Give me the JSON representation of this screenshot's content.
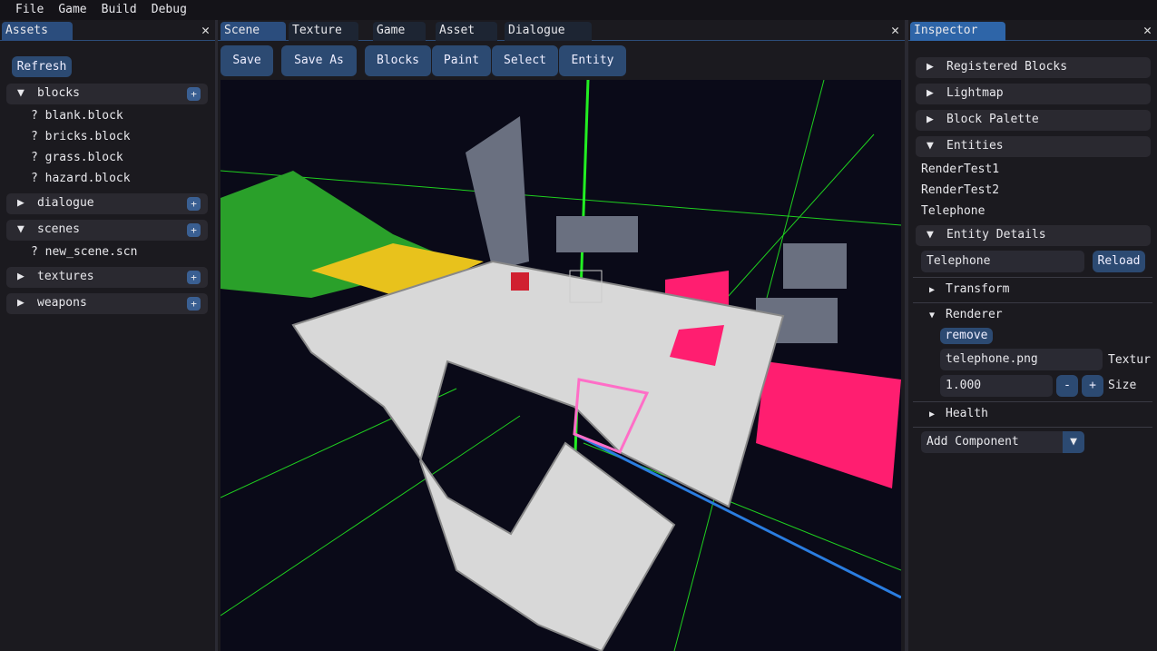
{
  "menu": [
    "File",
    "Game",
    "Build",
    "Debug"
  ],
  "assets": {
    "tab": "Assets",
    "refresh": "Refresh",
    "folders": [
      {
        "name": "blocks",
        "open": true,
        "files": [
          "? blank.block",
          "? bricks.block",
          "? grass.block",
          "? hazard.block"
        ]
      },
      {
        "name": "dialogue",
        "open": false,
        "files": []
      },
      {
        "name": "scenes",
        "open": true,
        "files": [
          "? new_scene.scn"
        ]
      },
      {
        "name": "textures",
        "open": false,
        "files": []
      },
      {
        "name": "weapons",
        "open": false,
        "files": []
      }
    ]
  },
  "center": {
    "tabs": [
      "Scene",
      "Texture",
      "Game",
      "Asset",
      "Dialogue"
    ],
    "toolbar": [
      "Save",
      "Save As",
      "Blocks",
      "Paint",
      "Select",
      "Entity"
    ]
  },
  "inspector": {
    "tab": "Inspector",
    "sections": [
      "Registered Blocks",
      "Lightmap",
      "Block Palette",
      "Entities"
    ],
    "entities": [
      "RenderTest1",
      "RenderTest2",
      "Telephone"
    ],
    "details_header": "Entity Details",
    "name_value": "Telephone",
    "reload": "Reload",
    "transform": "Transform",
    "renderer": "Renderer",
    "remove": "remove",
    "texture_value": "telephone.png",
    "texture_label": "Textur",
    "size_value": "1.000",
    "minus": "-",
    "plus": "+",
    "size_label": "Size",
    "health": "Health",
    "add_component": "Add Component"
  },
  "colors": {
    "accent": "#2b4d7d",
    "button": "#2c4a72",
    "viewport_bg": "#0a0a18"
  }
}
